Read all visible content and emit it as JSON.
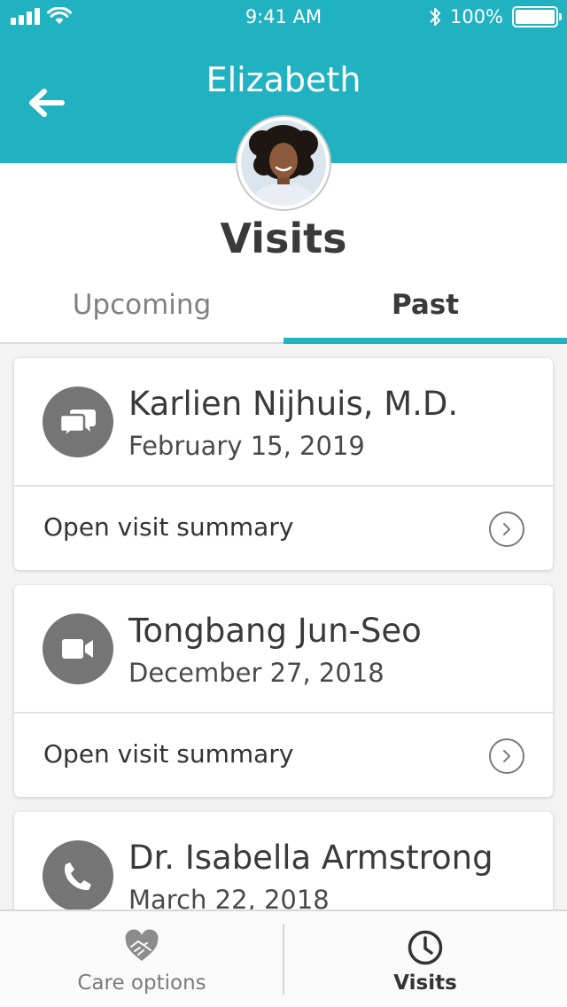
{
  "status_bar": {
    "time": "9:41 AM",
    "battery_percent": "100%",
    "battery_level": 1.0
  },
  "header": {
    "title": "Elizabeth",
    "back_icon": "arrow-left-icon",
    "avatar": "patient-avatar"
  },
  "page_title": "Visits",
  "tabs": [
    {
      "label": "Upcoming",
      "active": false
    },
    {
      "label": "Past",
      "active": true
    }
  ],
  "visits": [
    {
      "provider": "Karlien Nijhuis, M.D.",
      "date": "February 15, 2019",
      "type_icon": "chat-bubbles-icon",
      "action_label": "Open visit summary",
      "action_icon": "chevron-right-circle-icon"
    },
    {
      "provider": "Tongbang Jun-Seo",
      "date": "December 27, 2018",
      "type_icon": "video-camera-icon",
      "action_label": "Open visit summary",
      "action_icon": "chevron-right-circle-icon"
    },
    {
      "provider": "Dr. Isabella Armstrong",
      "date": "March 22, 2018",
      "type_icon": "phone-icon"
    }
  ],
  "bottom_nav": [
    {
      "label": "Care options",
      "icon": "handshake-heart-icon",
      "active": false
    },
    {
      "label": "Visits",
      "icon": "clock-icon",
      "active": true
    }
  ],
  "colors": {
    "accent": "#20b2c0",
    "icon_gray": "#757575",
    "background": "#f3f3f3"
  }
}
